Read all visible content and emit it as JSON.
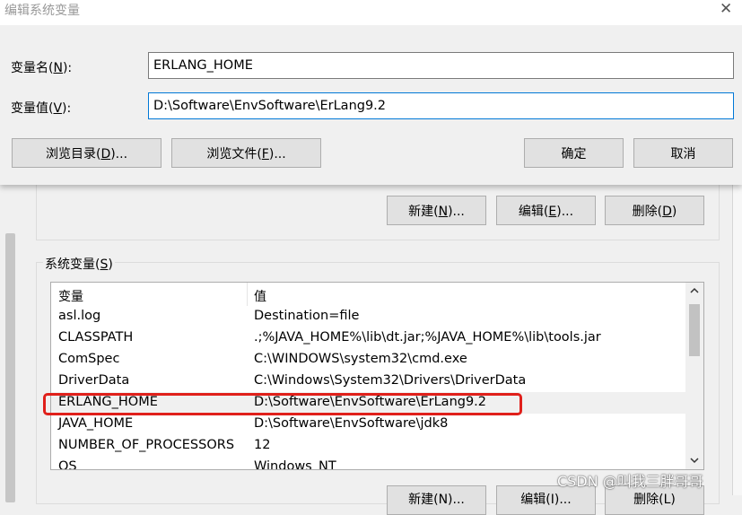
{
  "dialog": {
    "title": "编辑系统变量",
    "close_glyph": "✕",
    "name_label": "变量名(",
    "name_key": "N",
    "name_label_end": "):",
    "name_value": "ERLANG_HOME",
    "value_label": "变量值(",
    "value_key": "V",
    "value_label_end": "):",
    "value_value": "D:\\Software\\EnvSoftware\\ErLang9.2",
    "browse_dir_label": "浏览目录(",
    "browse_dir_key": "D",
    "browse_dir_end": ")...",
    "browse_file_label": "浏览文件(",
    "browse_file_key": "F",
    "browse_file_end": ")...",
    "ok_label": "确定",
    "cancel_label": "取消"
  },
  "background": {
    "user_buttons": {
      "new_label": "新建(",
      "new_key": "N",
      "new_end": ")...",
      "edit_label": "编辑(",
      "edit_key": "E",
      "edit_end": ")...",
      "delete_label": "删除(",
      "delete_key": "D",
      "delete_end": ")"
    },
    "system_vars_label": "系统变量(",
    "system_vars_key": "S",
    "system_vars_end": ")",
    "table": {
      "col_variable": "变量",
      "col_value": "值",
      "rows": [
        {
          "name": "asl.log",
          "value": "Destination=file"
        },
        {
          "name": "CLASSPATH",
          "value": ".;%JAVA_HOME%\\lib\\dt.jar;%JAVA_HOME%\\lib\\tools.jar"
        },
        {
          "name": "ComSpec",
          "value": "C:\\WINDOWS\\system32\\cmd.exe"
        },
        {
          "name": "DriverData",
          "value": "C:\\Windows\\System32\\Drivers\\DriverData"
        },
        {
          "name": "ERLANG_HOME",
          "value": "D:\\Software\\EnvSoftware\\ErLang9.2"
        },
        {
          "name": "JAVA_HOME",
          "value": "D:\\Software\\EnvSoftware\\jdk8"
        },
        {
          "name": "NUMBER_OF_PROCESSORS",
          "value": "12"
        },
        {
          "name": "OS",
          "value": "Windows_NT"
        }
      ]
    },
    "bottom_buttons": {
      "new_label": "新建(N)...",
      "edit_label": "编辑(I)...",
      "delete_label": "删除(L)"
    }
  },
  "watermark": "CSDN @叫我三胖哥哥",
  "colors": {
    "highlight_box": "#e0201b",
    "focus_border": "#0078d7"
  }
}
